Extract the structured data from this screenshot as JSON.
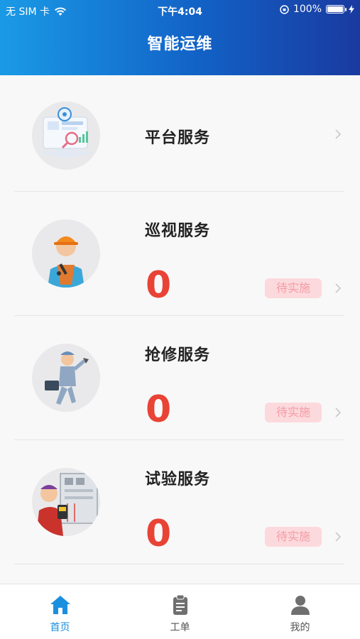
{
  "status_bar": {
    "carrier": "无 SIM 卡",
    "time": "下午4:04",
    "battery_text": "100%",
    "battery_level": 1.0
  },
  "header": {
    "title": "智能运维"
  },
  "services": [
    {
      "title": "平台服务",
      "icon": "platform-monitor-illustration"
    },
    {
      "title": "巡视服务",
      "count": "0",
      "status": "待实施",
      "icon": "inspection-worker-illustration"
    },
    {
      "title": "抢修服务",
      "count": "0",
      "status": "待实施",
      "icon": "repair-worker-illustration"
    },
    {
      "title": "试验服务",
      "count": "0",
      "status": "待实施",
      "icon": "testing-engineer-illustration"
    }
  ],
  "tabs": [
    {
      "label": "首页",
      "icon": "home-icon",
      "active": true
    },
    {
      "label": "工单",
      "icon": "clipboard-icon",
      "active": false
    },
    {
      "label": "我的",
      "icon": "person-icon",
      "active": false
    }
  ],
  "colors": {
    "header_gradient_start": "#1a9ae6",
    "header_gradient_end": "#1a3aa0",
    "count": "#e84335",
    "badge_bg": "#fcd9dd",
    "badge_text": "#f39ca5",
    "tab_active": "#1a8fe0"
  }
}
